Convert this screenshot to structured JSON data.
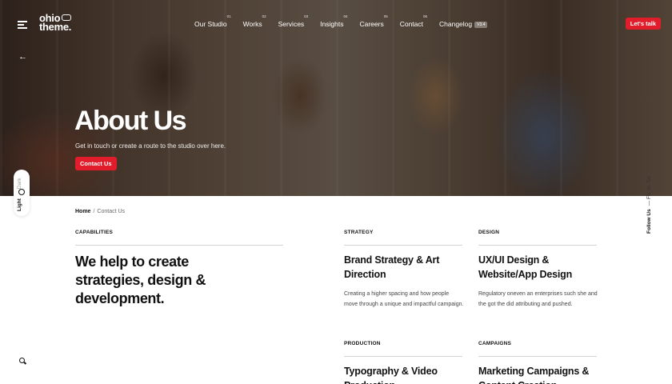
{
  "logo": {
    "line1": "ohio",
    "line2": "theme."
  },
  "nav": [
    {
      "label": "Our Studio",
      "num": "01"
    },
    {
      "label": "Works",
      "num": "02"
    },
    {
      "label": "Services",
      "num": "03"
    },
    {
      "label": "Insights",
      "num": "04"
    },
    {
      "label": "Careers",
      "num": "05"
    },
    {
      "label": "Contact",
      "num": "06"
    },
    {
      "label": "Changelog",
      "badge": "V3.4"
    }
  ],
  "cta_top": "Let's talk",
  "hero": {
    "title": "About Us",
    "subtitle": "Get in touch or create a route to the studio over here.",
    "button": "Contact Us"
  },
  "side": {
    "light_label": "Light",
    "dark_label": "Dark",
    "follow_label": "Follow Us",
    "follow_links": "— Fb. In. Tw."
  },
  "breadcrumb": {
    "home": "Home",
    "separator": "/",
    "current": "Contact Us"
  },
  "capabilities": {
    "label": "CAPABILITIES",
    "lead": "We help to create strategies, design & development."
  },
  "cards": [
    {
      "label": "STRATEGY",
      "title": "Brand Strategy & Art Direction",
      "desc": "Creating a higher spacing and how people move through a unique and impactful campaign."
    },
    {
      "label": "DESIGN",
      "title": "UX/UI Design & Website/App Design",
      "desc": "Regulatory oneven an enterprises such she and the got the did attributing and pushed."
    },
    {
      "label": "PRODUCTION",
      "title": "Typography & Video Production",
      "desc": ""
    },
    {
      "label": "CAMPAIGNS",
      "title": "Marketing Campaigns & Content Creation",
      "desc": ""
    }
  ],
  "colors": {
    "accent": "#e21d2b",
    "text": "#111111"
  },
  "icons": [
    "menu-icon",
    "back-arrow-icon",
    "sun-icon",
    "search-icon",
    "glasses-icon"
  ]
}
